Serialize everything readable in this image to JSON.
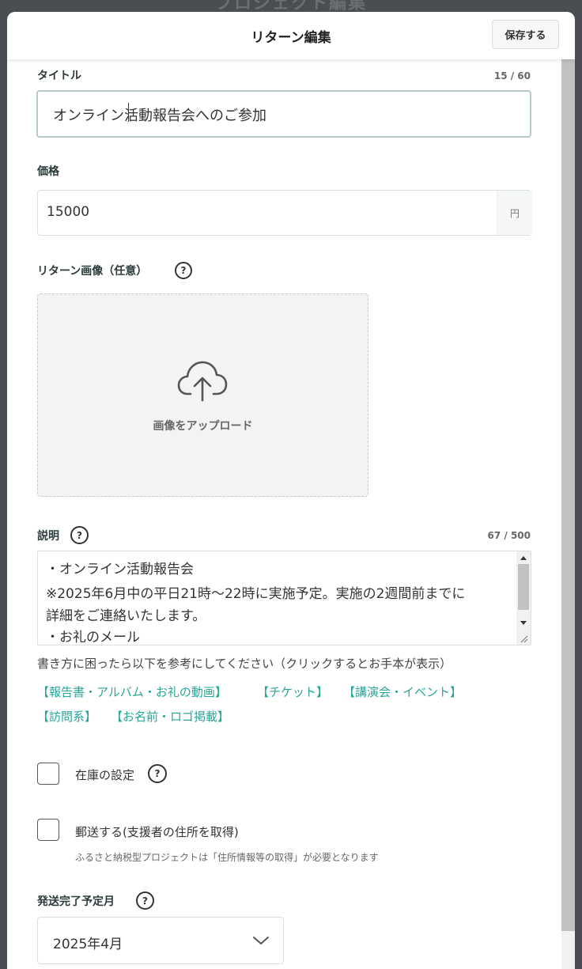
{
  "background_title": "プロジェクト編集",
  "modal": {
    "title": "リターン編集",
    "save_label": "保存する"
  },
  "title_field": {
    "label": "タイトル",
    "counter": "15 / 60",
    "value": "オンライン活動報告会へのご参加"
  },
  "price_field": {
    "label": "価格",
    "value": "15000",
    "unit": "円"
  },
  "image_field": {
    "label": "リターン画像（任意）",
    "upload_label": "画像をアップロード"
  },
  "description_field": {
    "label": "説明",
    "counter": "67 / 500",
    "lines": [
      "・オンライン活動報告会",
      "※2025年6月中の平日21時〜22時に実施予定。実施の2週間前までに",
      "詳細をご連絡いたします。",
      "・お礼のメール"
    ],
    "hint": "書き方に困ったら以下を参考にしてください（クリックするとお手本が表示）",
    "templates": [
      "【報告書・アルバム・お礼の動画】",
      "【チケット】",
      "【講演会・イベント】",
      "【訪問系】",
      "【お名前・ロゴ掲載】"
    ]
  },
  "stock_option": {
    "label": "在庫の設定"
  },
  "shipping_option": {
    "label": "郵送する(支援者の住所を取得)",
    "note": "ふるさと納税型プロジェクトは「住所情報等の取得」が必要となります"
  },
  "delivery_month": {
    "label": "発送完了予定月",
    "value": "2025年4月"
  },
  "colors": {
    "accent": "#26a69a",
    "overlay": "#4a4d52"
  }
}
